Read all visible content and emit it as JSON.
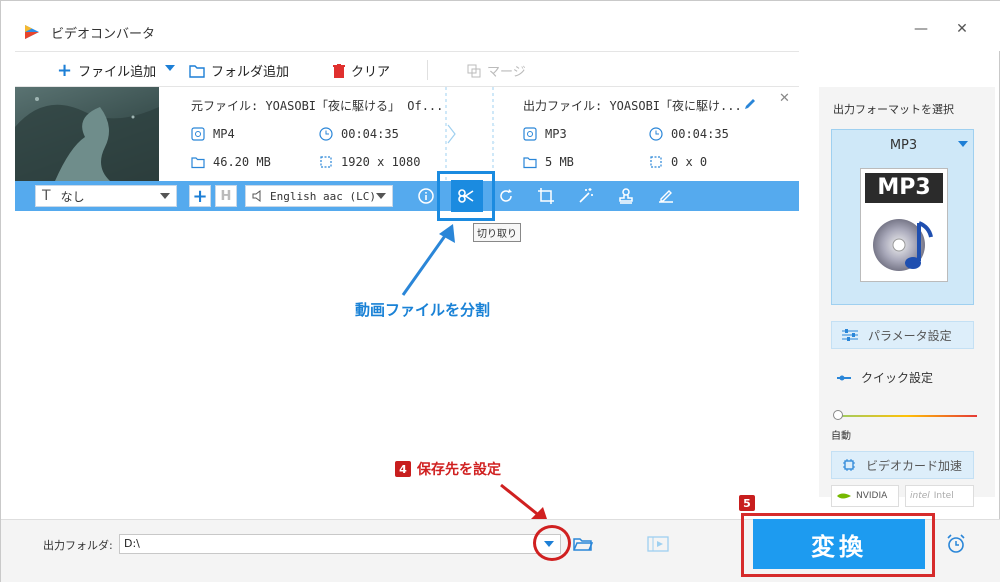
{
  "window": {
    "title": "ビデオコンバータ",
    "minimize": "—",
    "close": "✕"
  },
  "toolbar": {
    "add_file": "ファイル追加",
    "add_folder": "フォルダ追加",
    "clear": "クリア",
    "merge": "マージ"
  },
  "file": {
    "source_name": "元ファイル: YOASOBI「夜に駆ける」 Of...",
    "source_format": "MP4",
    "source_duration": "00:04:35",
    "source_size": "46.20 MB",
    "source_resolution": "1920 x 1080",
    "output_name": "出力ファイル: YOASOBI「夜に駆け...",
    "output_format": "MP3",
    "output_duration": "00:04:35",
    "output_size": "5 MB",
    "output_resolution": "0 x 0"
  },
  "editbar": {
    "subtitle": "なし",
    "audio_track": "English aac (LC)",
    "tooltip": "切り取り"
  },
  "annotations": {
    "split": "動画ファイルを分割",
    "save_dest": "保存先を設定",
    "step4": "4",
    "step5": "5"
  },
  "right_panel": {
    "title": "出力フォーマットを選択",
    "format": "MP3",
    "format_icon_text": "MP3",
    "param_settings": "パラメータ設定",
    "quick_settings": "クイック設定",
    "auto_label": "自動",
    "gpu_accel": "ビデオカード加速",
    "nvidia": "NVIDIA",
    "intel": "Intel"
  },
  "bottom": {
    "output_folder_label": "出力フォルダ:",
    "output_folder_value": "D:\\",
    "convert": "変換"
  },
  "colors": {
    "accent": "#1d9bf0",
    "editbar": "#55aaee",
    "annotation_blue": "#1a82d6",
    "annotation_red": "#d02020"
  }
}
